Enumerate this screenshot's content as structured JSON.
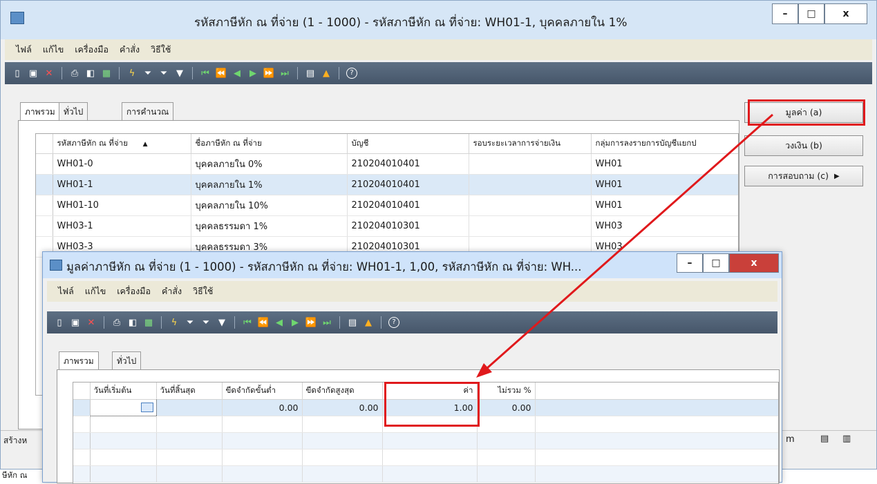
{
  "main_window": {
    "title": "รหัสภาษีหัก ณ ที่จ่าย (1 - 1000) - รหัสภาษีหัก ณ ที่จ่าย: WH01-1, บุคคลภายใน 1%",
    "window_buttons": {
      "minimize": "–",
      "maximize": "□",
      "close": "x"
    },
    "menu": [
      "ไฟล์",
      "แก้ไข",
      "เครื่องมือ",
      "คำสั่ง",
      "วิธีใช้"
    ],
    "tabs": [
      "ภาพรวม",
      "ทั่วไป",
      "การคำนวณ"
    ],
    "grid": {
      "columns": [
        "รหัสภาษีหัก ณ ที่จ่าย",
        "ชื่อภาษีหัก ณ ที่จ่าย",
        "บัญชี",
        "รอบระยะเวลาการจ่ายเงิน",
        "กลุ่มการลงรายการบัญชีแยกป"
      ],
      "sort_indicator": "▲",
      "rows": [
        [
          "WH01-0",
          "บุคคลภายใน 0%",
          "210204010401",
          "",
          "WH01"
        ],
        [
          "WH01-1",
          "บุคคลภายใน 1%",
          "210204010401",
          "",
          "WH01"
        ],
        [
          "WH01-10",
          "บุคคลภายใน 10%",
          "210204010401",
          "",
          "WH01"
        ],
        [
          "WH03-1",
          "บุคคลธรรมดา 1%",
          "210204010301",
          "",
          "WH03"
        ],
        [
          "WH03-3",
          "บุคคลธรรมดา 3%",
          "210204010301",
          "",
          "WH03"
        ]
      ]
    },
    "side_buttons": [
      "มูลค่า (a)",
      "วงเงิน (b)",
      "การสอบถาม (c)"
    ],
    "status_left": "สร้างห",
    "status_right_letter": "m",
    "bottom_text": "ษีหัก ณ"
  },
  "value_window": {
    "title": "มูลค่าภาษีหัก ณ ที่จ่าย (1 - 1000) - รหัสภาษีหัก ณ ที่จ่าย: WH01-1, 1,00, รหัสภาษีหัก ณ ที่จ่าย: WH...",
    "window_buttons": {
      "minimize": "–",
      "maximize": "□",
      "close": "x"
    },
    "menu": [
      "ไฟล์",
      "แก้ไข",
      "เครื่องมือ",
      "คำสั่ง",
      "วิธีใช้"
    ],
    "tabs": [
      "ภาพรวม",
      "ทั่วไป"
    ],
    "grid": {
      "columns": [
        "วันที่เริ่มต้น",
        "วันที่สิ้นสุด",
        "ขีดจำกัดขั้นต่ำ",
        "ขีดจำกัดสูงสุด",
        "ค่า",
        "ไม่รวม %"
      ],
      "row": [
        "",
        "",
        "0.00",
        "0.00",
        "1.00",
        "0.00"
      ]
    }
  },
  "colors": {
    "highlight": "#e0191c",
    "toolbar": "#4f6075",
    "selected_row": "#dbe9f7"
  },
  "icons": {
    "toolbar": [
      "new-icon",
      "save-icon",
      "delete-icon",
      "print-icon",
      "print-preview-icon",
      "excel-icon",
      "filter-by-selection-icon",
      "filter-by-grid-icon",
      "advanced-filter-icon",
      "remove-filter-icon",
      "first-record-icon",
      "previous-page-icon",
      "previous-record-icon",
      "next-record-icon",
      "next-page-icon",
      "last-record-icon",
      "attachments-icon",
      "alert-icon",
      "help-icon"
    ]
  }
}
